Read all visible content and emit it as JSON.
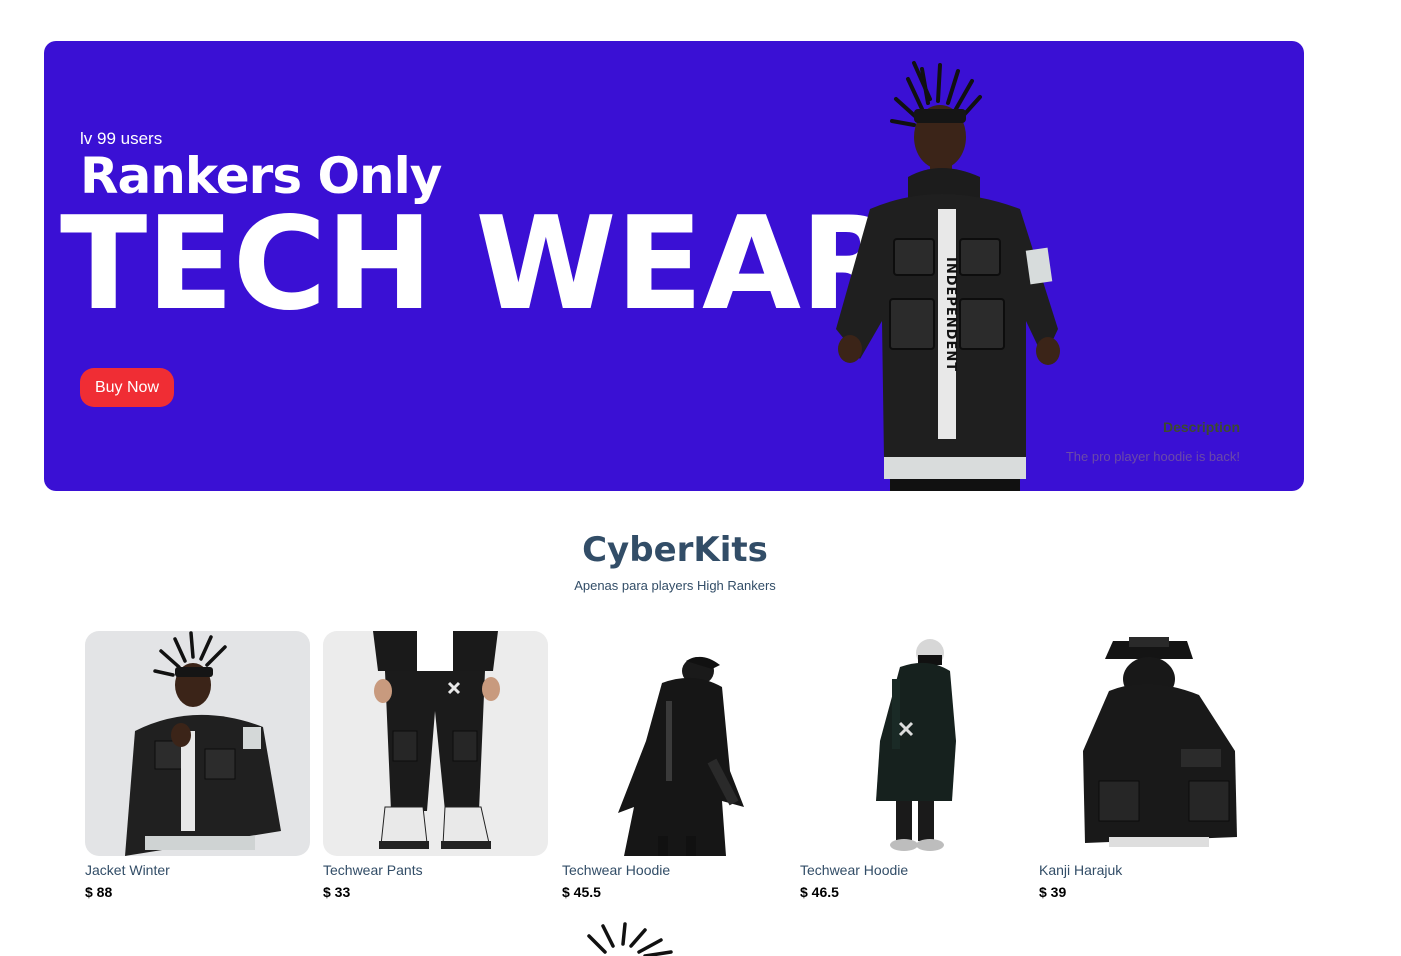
{
  "hero": {
    "tag": "lv 99 users",
    "subtitle": "Rankers Only",
    "title": "TECH WEAR",
    "button_label": "Buy Now",
    "desc_title": "Description",
    "desc_text": "The pro player hoodie is back!",
    "figure_print": "INDEPENDENT",
    "colors": {
      "background": "#3a10d4",
      "button": "#f02d34"
    }
  },
  "section": {
    "title": "CyberKits",
    "subtitle": "Apenas para players High Rankers"
  },
  "products": [
    {
      "name": "Jacket Winter",
      "price": "$ 88",
      "image": "jacket-winter-image"
    },
    {
      "name": "Techwear Pants",
      "price": "$ 33",
      "image": "techwear-pants-image"
    },
    {
      "name": "Techwear Hoodie",
      "price": "$ 45.5",
      "image": "techwear-hoodie-image"
    },
    {
      "name": "Techwear Hoodie",
      "price": "$ 46.5",
      "image": "techwear-hoodie-image"
    },
    {
      "name": "Kanji Harajuk",
      "price": "$ 39",
      "image": "kanji-harajuk-image"
    }
  ]
}
